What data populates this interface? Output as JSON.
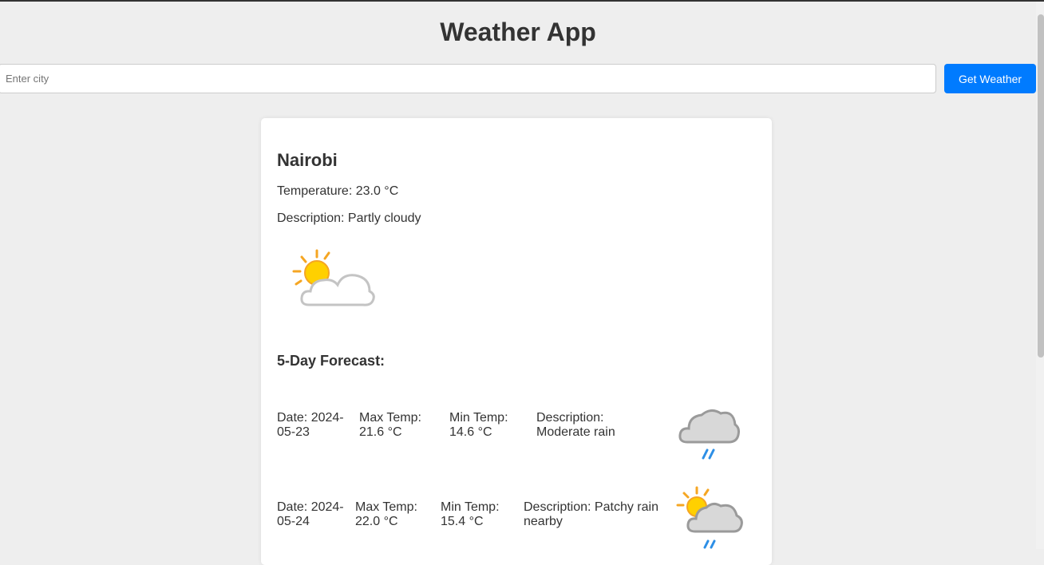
{
  "app": {
    "title": "Weather App"
  },
  "search": {
    "placeholder": "Enter city",
    "value": "",
    "button_label": "Get Weather"
  },
  "current": {
    "city": "Nairobi",
    "temperature_text": "Temperature: 23.0 °C",
    "description_text": "Description: Partly cloudy",
    "icon": "partly-cloudy-icon"
  },
  "forecast": {
    "heading": "5-Day Forecast:",
    "days": [
      {
        "date_line1": "Date: 2024-",
        "date_line2": "05-23",
        "max_line1": "Max Temp:",
        "max_line2": "21.6 °C",
        "min_line1": "Min Temp:",
        "min_line2": "14.6 °C",
        "desc_line1": "Description:",
        "desc_line2": "Moderate rain",
        "icon": "moderate-rain-icon"
      },
      {
        "date_line1": "Date: 2024-",
        "date_line2": "05-24",
        "max_line1": "Max Temp:",
        "max_line2": "22.0 °C",
        "min_line1": "Min Temp:",
        "min_line2": "15.4 °C",
        "desc_line1": "Description: Patchy rain",
        "desc_line2": "nearby",
        "icon": "patchy-rain-icon"
      }
    ]
  },
  "colors": {
    "accent": "#007bff",
    "background": "#eeeeee",
    "card": "#ffffff",
    "text": "#333333"
  }
}
